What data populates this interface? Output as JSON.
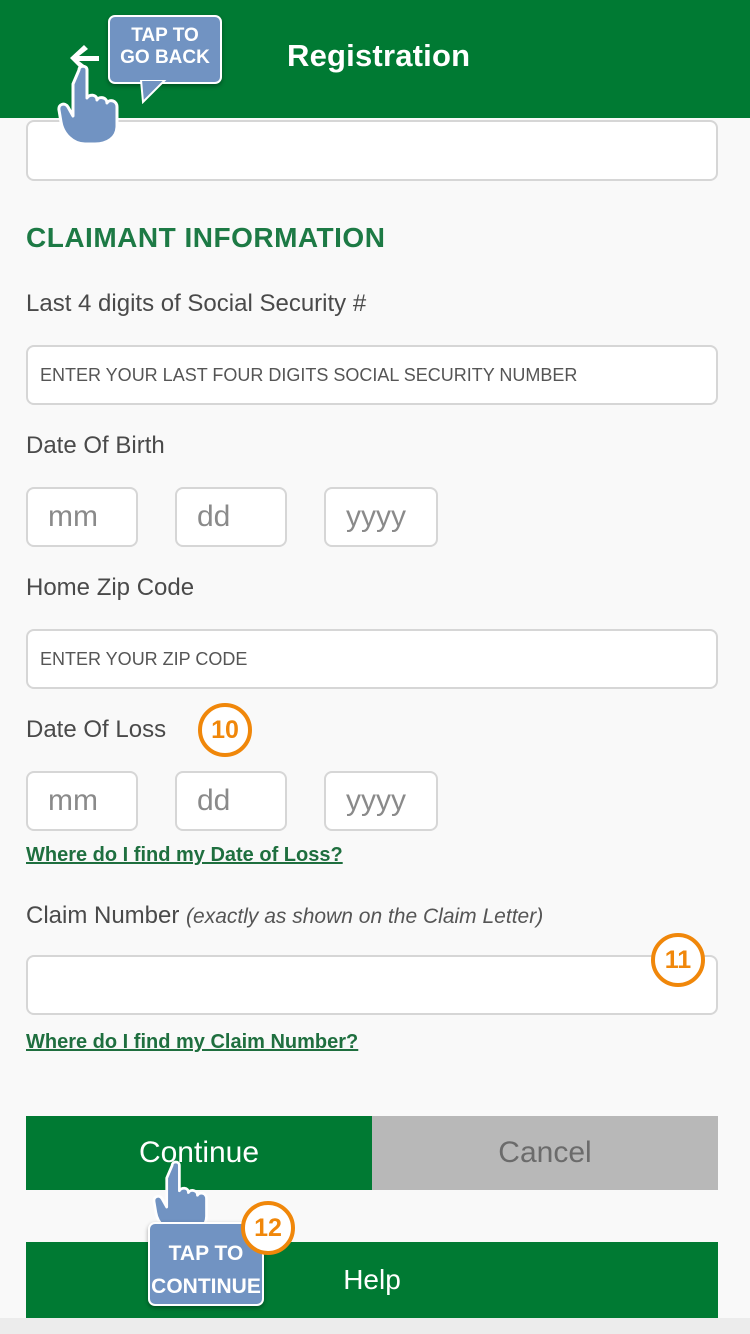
{
  "header": {
    "title": "Registration",
    "back_hint": [
      "TAP TO",
      "GO BACK"
    ]
  },
  "section": {
    "title": "CLAIMANT INFORMATION"
  },
  "ssn": {
    "label": "Last 4 digits of Social Security #",
    "placeholder": "ENTER YOUR LAST FOUR DIGITS SOCIAL SECURITY NUMBER"
  },
  "dob": {
    "label": "Date Of Birth",
    "mm_placeholder": "mm",
    "dd_placeholder": "dd",
    "yyyy_placeholder": "yyyy"
  },
  "zip": {
    "label": "Home Zip Code",
    "placeholder": "ENTER YOUR ZIP CODE"
  },
  "dol": {
    "label": "Date Of Loss",
    "mm_placeholder": "mm",
    "dd_placeholder": "dd",
    "yyyy_placeholder": "yyyy",
    "help_link": "Where do I find my Date of Loss?"
  },
  "claim": {
    "label": "Claim Number",
    "label_note": "(exactly as shown on the Claim Letter)",
    "help_link": "Where do I find my Claim Number?"
  },
  "badges": {
    "b10": "10",
    "b11": "11",
    "b12": "12"
  },
  "buttons": {
    "continue": "Continue",
    "cancel": "Cancel",
    "help": "Help"
  },
  "continue_hint": [
    "TAP TO",
    "CONTINUE"
  ],
  "colors": {
    "brand_green": "#007a33",
    "hint_blue": "#7193c2",
    "badge_orange": "#f0870a",
    "cancel_gray": "#b8b8b8"
  }
}
